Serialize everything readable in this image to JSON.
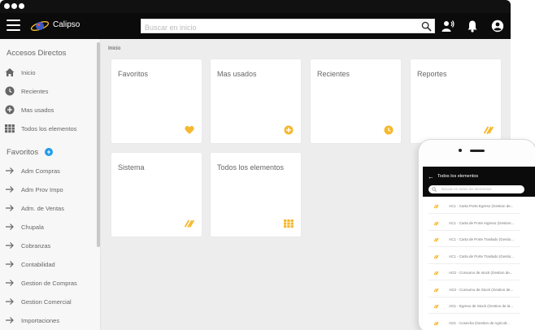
{
  "app": {
    "name": "Calipso"
  },
  "search": {
    "placeholder": "Buscar en inicio"
  },
  "sidebar": {
    "accesos_title": "Accesos Directos",
    "accesos": [
      {
        "label": "Inicio",
        "icon": "home-icon"
      },
      {
        "label": "Recientes",
        "icon": "clock-icon"
      },
      {
        "label": "Mas usados",
        "icon": "plus-circle-icon"
      },
      {
        "label": "Todos los elementos",
        "icon": "grid-icon"
      }
    ],
    "favoritos_title": "Favoritos",
    "favoritos": [
      {
        "label": "Adm Compras"
      },
      {
        "label": "Adm Prov Impo"
      },
      {
        "label": "Adm. de Ventas"
      },
      {
        "label": "Chupala"
      },
      {
        "label": "Cobranzas"
      },
      {
        "label": "Contabilidad"
      },
      {
        "label": "Gestion de Compras"
      },
      {
        "label": "Gestion Comercial"
      },
      {
        "label": "Importaciones"
      }
    ]
  },
  "breadcrumb": "Inicio",
  "cards": [
    {
      "title": "Favoritos",
      "icon": "heart-icon"
    },
    {
      "title": "Mas usados",
      "icon": "plus-circle-icon"
    },
    {
      "title": "Recientes",
      "icon": "clock-icon"
    },
    {
      "title": "Reportes",
      "icon": "link-icon"
    },
    {
      "title": "Sistema",
      "icon": "link-icon"
    },
    {
      "title": "Todos los elementos",
      "icon": "grid-icon"
    }
  ],
  "phone": {
    "title": "Todos los elementos",
    "search_placeholder": "Buscar en todos los elementos",
    "rows": [
      "AC1 - Carta Porte Egreso (Gestion de...",
      "AC1 - Carta de Porte Ingreso (Gestion...",
      "AC1 - Carta de Porte Traslado (Gestio...",
      "AC1 - Carta de Porte Traslado (Gestio...",
      "AG2 - Consumo de stock (Gestion de...",
      "AG2 - Consumo de Stock (Gestion de...",
      "AG1 - Egreso de Stock (Gestion de la...",
      "AG1 - Cosecha (Gestion de Agricult..."
    ]
  },
  "colors": {
    "accent": "#f5b82e",
    "topbar": "#0b0b0b",
    "badge": "#1e9be9"
  }
}
